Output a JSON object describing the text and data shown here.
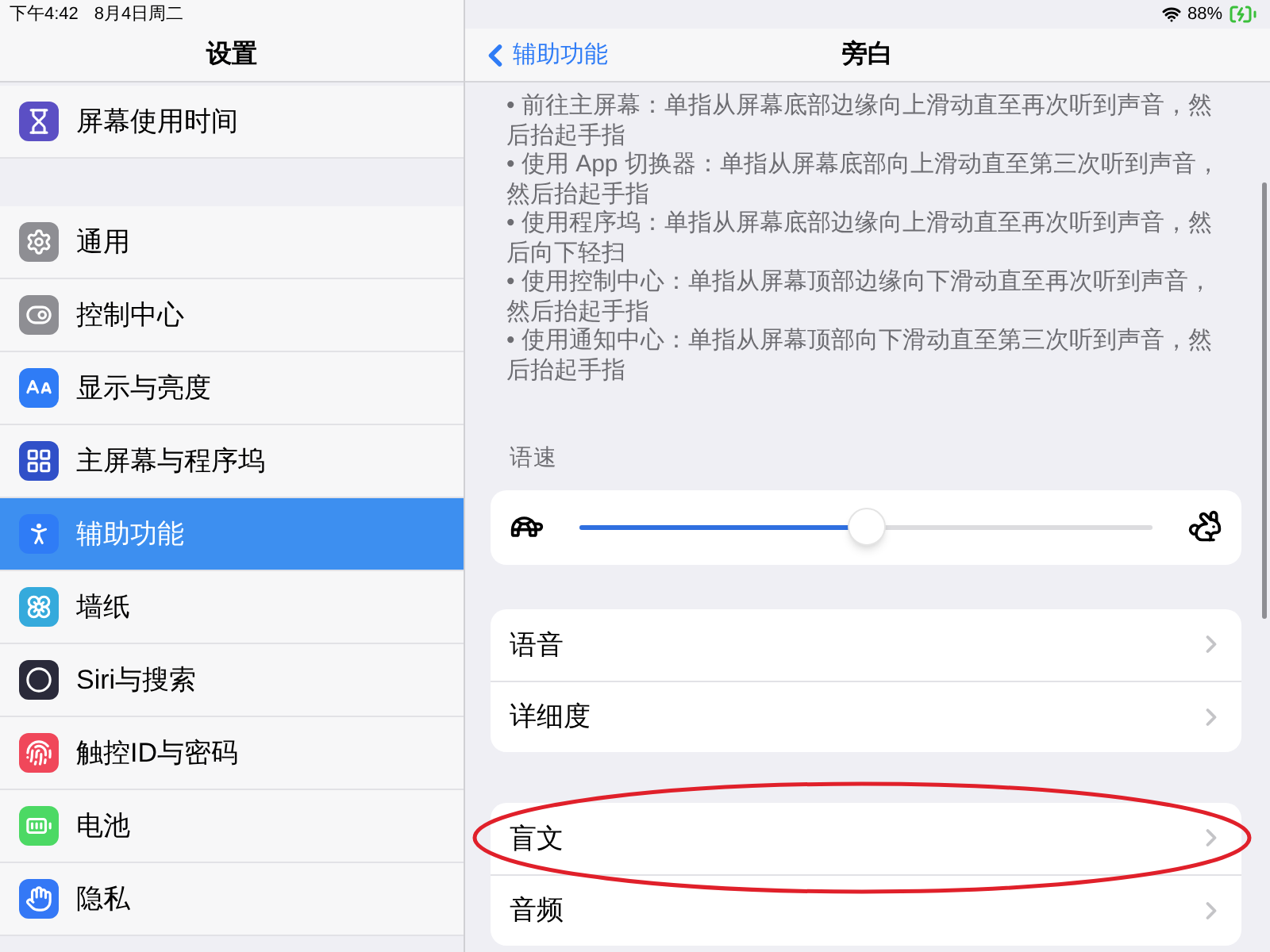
{
  "status_bar": {
    "time": "下午4:42",
    "date": "8月4日周二",
    "battery": "88%"
  },
  "sidebar": {
    "title": "设置",
    "groups": [
      {
        "items": [
          {
            "label": "屏幕使用时间",
            "kind": "hourglass",
            "color": "#5b4fc4",
            "selected": false
          }
        ]
      },
      {
        "items": [
          {
            "label": "通用",
            "kind": "gear",
            "color": "#8e8e93",
            "selected": false
          },
          {
            "label": "控制中心",
            "kind": "toggles",
            "color": "#8e8e93",
            "selected": false
          },
          {
            "label": "显示与亮度",
            "kind": "text-size",
            "color": "#2f7cf6",
            "selected": false
          },
          {
            "label": "主屏幕与程序坞",
            "kind": "grid",
            "color": "#3050c8",
            "selected": false
          },
          {
            "label": "辅助功能",
            "kind": "accessibility",
            "color": "#2f7cf6",
            "selected": true
          },
          {
            "label": "墙纸",
            "kind": "flower",
            "color": "#35aadc",
            "selected": false
          },
          {
            "label": "Siri与搜索",
            "kind": "orb",
            "color": "#2a2a3a",
            "selected": false
          },
          {
            "label": "触控ID与密码",
            "kind": "fingerprint",
            "color": "#f0475a",
            "selected": false
          },
          {
            "label": "电池",
            "kind": "battery",
            "color": "#4cd964",
            "selected": false
          },
          {
            "label": "隐私",
            "kind": "hand",
            "color": "#3478f6",
            "selected": false
          }
        ]
      }
    ]
  },
  "detail": {
    "back": "辅助功能",
    "title": "旁白",
    "gestures": [
      "• 前往主屏幕：单指从屏幕底部边缘向上滑动直至再次听到声音，然后抬起手指",
      "• 使用 App 切换器：单指从屏幕底部向上滑动直至第三次听到声音，然后抬起手指",
      "• 使用程序坞：单指从屏幕底部边缘向上滑动直至再次听到声音，然后向下轻扫",
      "• 使用控制中心：单指从屏幕顶部边缘向下滑动直至再次听到声音，然后抬起手指",
      "• 使用通知中心：单指从屏幕顶部向下滑动直至第三次听到声音，然后抬起手指"
    ],
    "speech_rate": {
      "label": "语速",
      "level": 0.5
    },
    "groups": [
      {
        "items": [
          {
            "label": "语音",
            "circled": false
          },
          {
            "label": "详细度",
            "circled": false
          }
        ]
      },
      {
        "items": [
          {
            "label": "盲文",
            "circled": true
          },
          {
            "label": "音频",
            "circled": false
          }
        ]
      }
    ]
  }
}
